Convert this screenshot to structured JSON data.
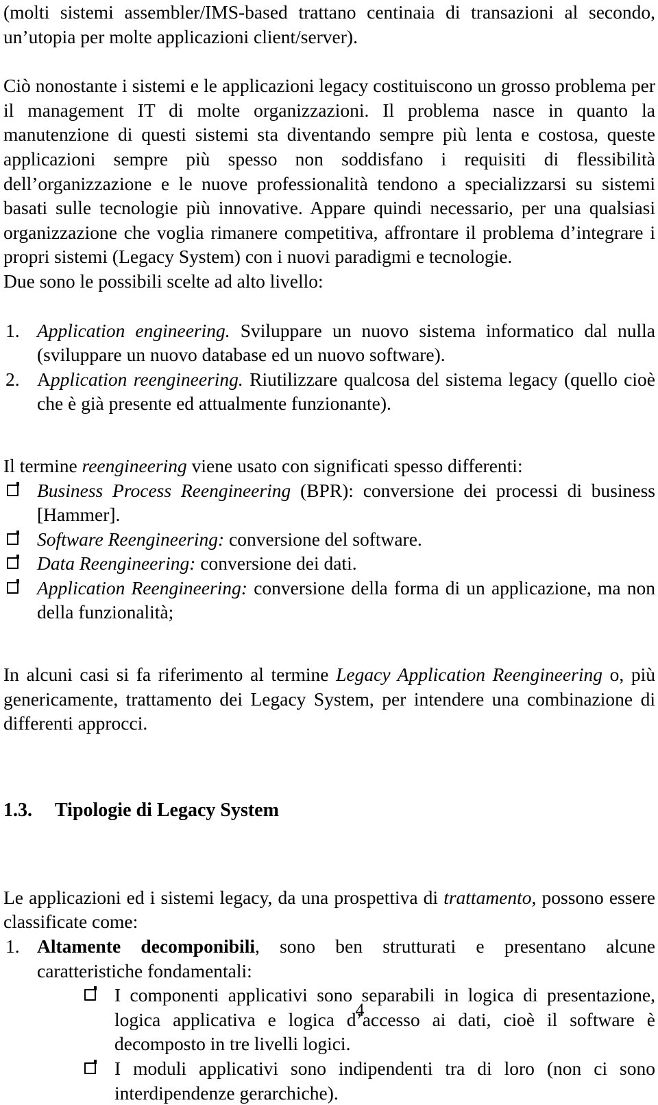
{
  "document": {
    "page_number": "4",
    "language": "it",
    "blocks": [
      {
        "id": "p1",
        "type": "paragraph",
        "text": "(molti sistemi assembler/IMS-based trattano centinaia di transazioni al secondo, un’utopia per molte applicazioni client/server)."
      },
      {
        "id": "p2",
        "type": "paragraph",
        "text": "Ciò nonostante i sistemi e le applicazioni legacy costituiscono un grosso problema per il management IT di molte organizzazioni. Il problema nasce in quanto la manutenzione di questi sistemi sta diventando sempre più lenta e costosa, queste applicazioni sempre più spesso non soddisfano i requisiti di flessibilità dell’organizzazione e le nuove professionalità tendono a specializzarsi su sistemi basati sulle tecnologie più innovative. Appare quindi necessario, per una qualsiasi organizzazione che voglia rimanere competitiva, affrontare il problema d’integrare i propri sistemi (Legacy System) con i nuovi paradigmi e tecnologie."
      },
      {
        "id": "p3",
        "type": "paragraph",
        "text": "Due sono le possibili scelte ad alto livello:"
      }
    ],
    "numbered_list": {
      "items": [
        {
          "marker": "1.",
          "term": "Application engineering.",
          "rest": " Sviluppare un nuovo sistema informatico dal nulla (sviluppare un nuovo database ed un nuovo software)."
        },
        {
          "marker": "2.",
          "term_lead": "A",
          "term": "pplication reengineering.",
          "rest": " Riutilizzare qualcosa del sistema legacy (quello cioè che è già presente ed attualmente funzionante)."
        }
      ]
    },
    "reengineering_intro": {
      "lead": "Il termine ",
      "italic": "reengineering",
      "tail": " viene usato con significati spesso differenti:"
    },
    "reengineering_bullets": {
      "bullet_icon": "open-square-bullet",
      "items": [
        {
          "italic": "Business Process Reengineering",
          "rest": " (BPR): conversione dei processi di business [Hammer]."
        },
        {
          "italic": "Software Reengineering:",
          "rest": " conversione del software."
        },
        {
          "italic": "Data Reengineering:",
          "rest": " conversione dei dati."
        },
        {
          "italic": "Application Reengineering:",
          "rest": " conversione della forma di un applicazione, ma non della funzionalità;"
        }
      ]
    },
    "closing_paragraph": {
      "lead": "In alcuni casi si fa riferimento al termine ",
      "italic": "Legacy Application Reengineering",
      "tail": " o, più genericamente, trattamento dei Legacy System, per intendere una combinazione di differenti approcci."
    },
    "section_heading": {
      "number": "1.3.",
      "title": "Tipologie di Legacy System"
    },
    "classification_intro": {
      "lead": "Le applicazioni ed i sistemi legacy, da una prospettiva di ",
      "italic": "trattamento",
      "tail": ", possono essere classificate come:"
    },
    "classification_list": {
      "items": [
        {
          "marker": "1.",
          "bold_term": "Altamente decomponibili",
          "rest": ", sono ben strutturati e presentano alcune caratteristiche fondamentali:"
        }
      ]
    },
    "classification_sub_bullets": {
      "bullet_icon": "open-square-bullet",
      "items": [
        {
          "text": "I componenti applicativi sono separabili in logica di presentazione, logica applicativa e logica d’accesso ai dati, cioè il software è decomposto in tre livelli logici."
        },
        {
          "text": "I moduli applicativi sono indipendenti tra di loro (non ci sono interdipendenze gerarchiche)."
        }
      ]
    }
  }
}
